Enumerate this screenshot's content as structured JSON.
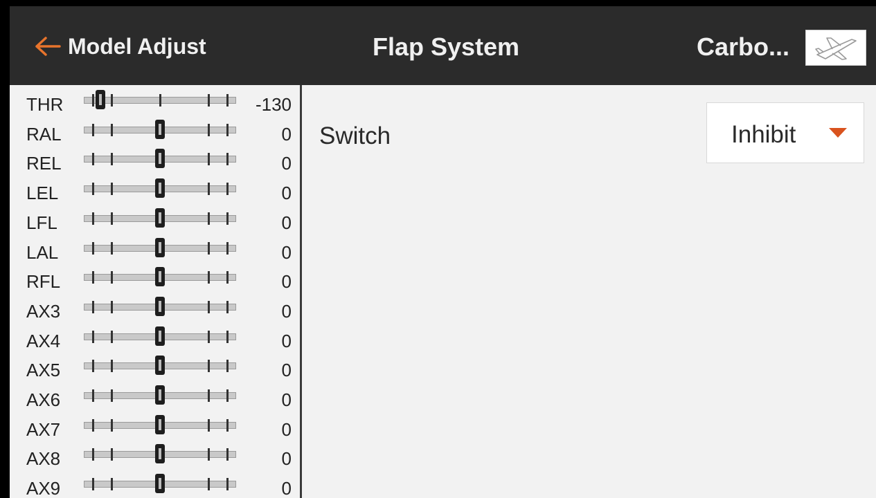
{
  "header": {
    "back_label": "Model Adjust",
    "title": "Flap System",
    "model_name": "Carbo...",
    "accent_color": "#e8742c",
    "model_icon": "airplane-icon"
  },
  "channels": [
    {
      "name": "THR",
      "value": "-130",
      "position": -1.0
    },
    {
      "name": "RAL",
      "value": "0",
      "position": 0
    },
    {
      "name": "REL",
      "value": "0",
      "position": 0
    },
    {
      "name": "LEL",
      "value": "0",
      "position": 0
    },
    {
      "name": "LFL",
      "value": "0",
      "position": 0
    },
    {
      "name": "LAL",
      "value": "0",
      "position": 0
    },
    {
      "name": "RFL",
      "value": "0",
      "position": 0
    },
    {
      "name": "AX3",
      "value": "0",
      "position": 0
    },
    {
      "name": "AX4",
      "value": "0",
      "position": 0
    },
    {
      "name": "AX5",
      "value": "0",
      "position": 0
    },
    {
      "name": "AX6",
      "value": "0",
      "position": 0
    },
    {
      "name": "AX7",
      "value": "0",
      "position": 0
    },
    {
      "name": "AX8",
      "value": "0",
      "position": 0
    },
    {
      "name": "AX9",
      "value": "0",
      "position": 0
    }
  ],
  "main": {
    "switch_label": "Switch",
    "switch_value": "Inhibit",
    "caret_color": "#d9531e"
  }
}
